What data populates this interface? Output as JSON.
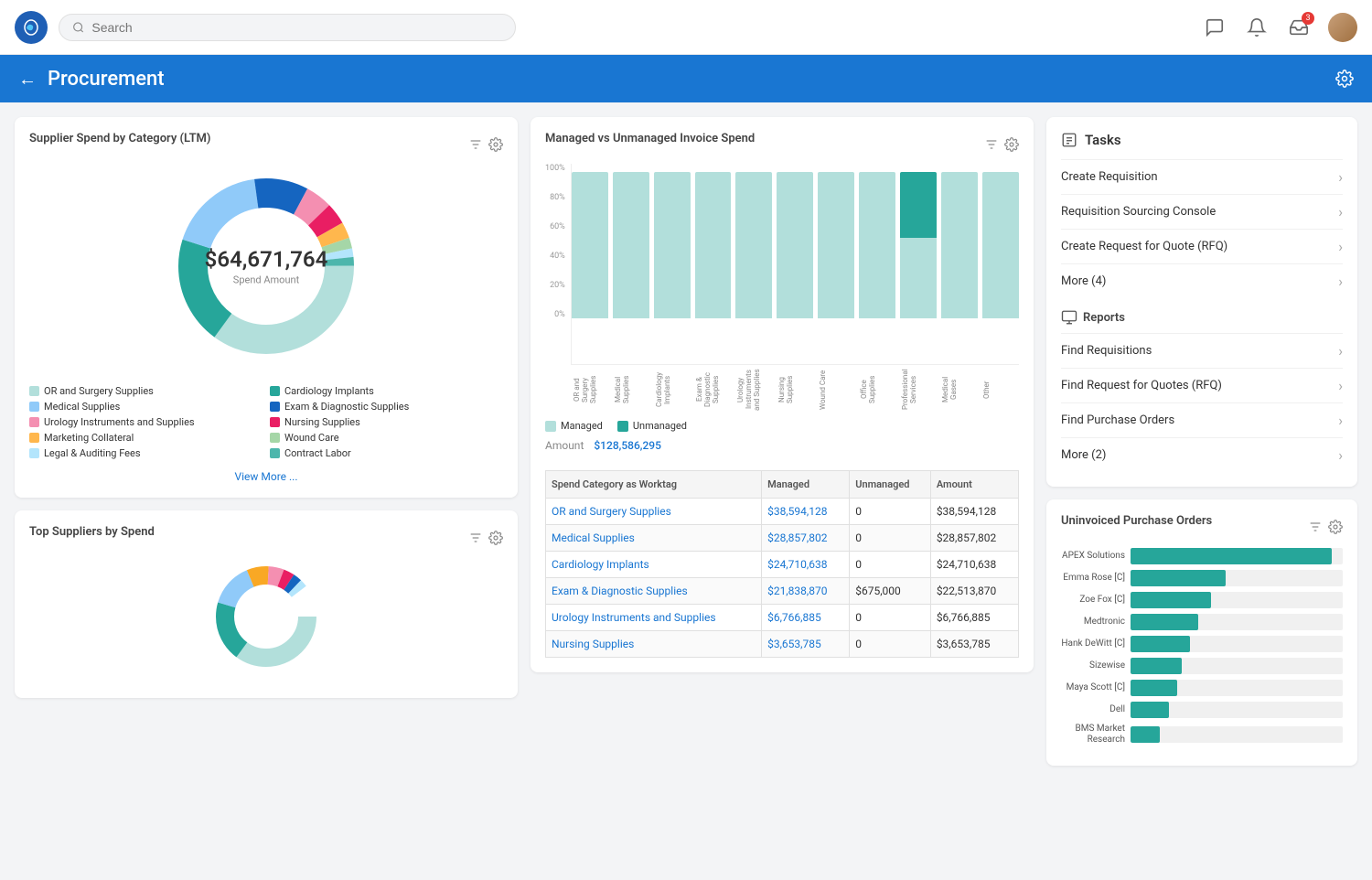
{
  "nav": {
    "logo": "W",
    "search_placeholder": "Search",
    "badge_count": "3"
  },
  "header": {
    "title": "Procurement",
    "back_label": "←"
  },
  "supplier_spend": {
    "card_title": "Supplier Spend by Category (LTM)",
    "center_amount": "$64,671,764",
    "center_label": "Spend Amount",
    "view_more": "View More ...",
    "legend": [
      {
        "label": "OR and Surgery Supplies",
        "color": "#b2dfdb"
      },
      {
        "label": "Cardiology Implants",
        "color": "#26a69a"
      },
      {
        "label": "Medical Supplies",
        "color": "#90caf9"
      },
      {
        "label": "Exam & Diagnostic Supplies",
        "color": "#1565c0"
      },
      {
        "label": "Urology Instruments and Supplies",
        "color": "#f48fb1"
      },
      {
        "label": "Nursing Supplies",
        "color": "#e91e63"
      },
      {
        "label": "Marketing Collateral",
        "color": "#ffb74d"
      },
      {
        "label": "Wound Care",
        "color": "#a5d6a7"
      },
      {
        "label": "Legal & Auditing Fees",
        "color": "#b3e5fc"
      },
      {
        "label": "Contract Labor",
        "color": "#4db6ac"
      }
    ],
    "segments": [
      {
        "pct": 35,
        "color": "#b2dfdb"
      },
      {
        "pct": 20,
        "color": "#26a69a"
      },
      {
        "pct": 18,
        "color": "#90caf9"
      },
      {
        "pct": 10,
        "color": "#1565c0"
      },
      {
        "pct": 5,
        "color": "#f48fb1"
      },
      {
        "pct": 4,
        "color": "#e91e63"
      },
      {
        "pct": 3,
        "color": "#ffb74d"
      },
      {
        "pct": 2,
        "color": "#a5d6a7"
      },
      {
        "pct": 1.5,
        "color": "#b3e5fc"
      },
      {
        "pct": 1.5,
        "color": "#4db6ac"
      }
    ]
  },
  "managed_vs_unmanaged": {
    "card_title": "Managed vs Unmanaged Invoice Spend",
    "amount_label": "Amount",
    "amount_value": "$128,586,295",
    "legend_managed": "Managed",
    "legend_unmanaged": "Unmanaged",
    "bars": [
      {
        "label": "OR and Surgery Supplies",
        "managed": 100,
        "unmanaged": 0
      },
      {
        "label": "Medical Supplies",
        "managed": 100,
        "unmanaged": 0
      },
      {
        "label": "Cardiology Implants",
        "managed": 100,
        "unmanaged": 0
      },
      {
        "label": "Exam & Diagnostic Supplies",
        "managed": 100,
        "unmanaged": 0
      },
      {
        "label": "Urology Instruments and Supplies",
        "managed": 100,
        "unmanaged": 0
      },
      {
        "label": "Nursing Supplies",
        "managed": 100,
        "unmanaged": 0
      },
      {
        "label": "Wound Care",
        "managed": 100,
        "unmanaged": 0
      },
      {
        "label": "Office Supplies",
        "managed": 100,
        "unmanaged": 0
      },
      {
        "label": "Professional Services",
        "managed": 55,
        "unmanaged": 45
      },
      {
        "label": "Medical Gases",
        "managed": 100,
        "unmanaged": 0
      },
      {
        "label": "Other",
        "managed": 100,
        "unmanaged": 0
      }
    ],
    "y_labels": [
      "100%",
      "80%",
      "60%",
      "40%",
      "20%",
      "0%"
    ],
    "table": {
      "headers": [
        "Spend Category as Worktag",
        "Managed",
        "Unmanaged",
        "Amount"
      ],
      "rows": [
        {
          "category": "OR and Surgery Supplies",
          "managed": "$38,594,128",
          "unmanaged": "0",
          "amount": "$38,594,128"
        },
        {
          "category": "Medical Supplies",
          "managed": "$28,857,802",
          "unmanaged": "0",
          "amount": "$28,857,802"
        },
        {
          "category": "Cardiology Implants",
          "managed": "$24,710,638",
          "unmanaged": "0",
          "amount": "$24,710,638"
        },
        {
          "category": "Exam & Diagnostic Supplies",
          "managed": "$21,838,870",
          "unmanaged": "$675,000",
          "amount": "$22,513,870"
        },
        {
          "category": "Urology Instruments and Supplies",
          "managed": "$6,766,885",
          "unmanaged": "0",
          "amount": "$6,766,885"
        },
        {
          "category": "Nursing Supplies",
          "managed": "$3,653,785",
          "unmanaged": "0",
          "amount": "$3,653,785"
        }
      ]
    }
  },
  "tasks": {
    "section_title": "Tasks",
    "items": [
      {
        "label": "Create Requisition"
      },
      {
        "label": "Requisition Sourcing Console"
      },
      {
        "label": "Create Request for Quote (RFQ)"
      },
      {
        "label": "More (4)"
      }
    ],
    "reports_title": "Reports",
    "reports": [
      {
        "label": "Find Requisitions"
      },
      {
        "label": "Find Request for Quotes (RFQ)"
      },
      {
        "label": "Find Purchase Orders"
      },
      {
        "label": "More (2)"
      }
    ]
  },
  "uninvoiced_po": {
    "card_title": "Uninvoiced Purchase Orders",
    "bars": [
      {
        "label": "APEX Solutions",
        "pct": 95
      },
      {
        "label": "Emma Rose [C]",
        "pct": 45
      },
      {
        "label": "Zoe Fox [C]",
        "pct": 38
      },
      {
        "label": "Medtronic",
        "pct": 32
      },
      {
        "label": "Hank DeWitt [C]",
        "pct": 28
      },
      {
        "label": "Sizewise",
        "pct": 24
      },
      {
        "label": "Maya Scott [C]",
        "pct": 22
      },
      {
        "label": "Dell",
        "pct": 18
      },
      {
        "label": "BMS Market Research",
        "pct": 14
      }
    ]
  },
  "top_suppliers": {
    "card_title": "Top Suppliers by Spend"
  }
}
